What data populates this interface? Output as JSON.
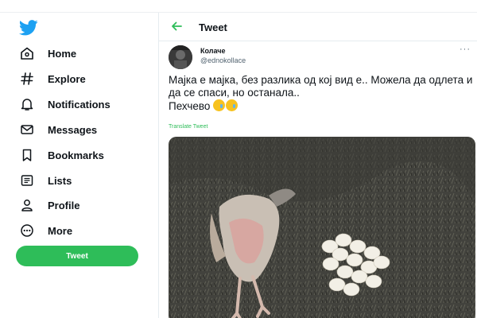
{
  "sidebar": {
    "logo_icon": "twitter-bird-icon",
    "items": [
      {
        "label": "Home",
        "icon": "home-icon"
      },
      {
        "label": "Explore",
        "icon": "hashtag-icon"
      },
      {
        "label": "Notifications",
        "icon": "bell-icon"
      },
      {
        "label": "Messages",
        "icon": "envelope-icon"
      },
      {
        "label": "Bookmarks",
        "icon": "bookmark-icon"
      },
      {
        "label": "Lists",
        "icon": "list-icon"
      },
      {
        "label": "Profile",
        "icon": "person-icon"
      },
      {
        "label": "More",
        "icon": "more-circle-icon"
      }
    ],
    "tweet_button": "Tweet"
  },
  "header": {
    "title": "Tweet",
    "back_icon": "arrow-left-icon"
  },
  "tweet": {
    "author_name": "Колаче",
    "author_handle": "@ednokollace",
    "text_line1": "Мајка е мајка, без разлика од кој вид е.. Можела да одлета и да се спаси, но останала..",
    "text_line2": "Пехчево",
    "emoji_count": 2,
    "translate_label": "Translate Tweet"
  },
  "colors": {
    "accent": "#2ebd59",
    "logo": "#1da1f2",
    "text": "#0f1419",
    "secondary": "#536471"
  }
}
